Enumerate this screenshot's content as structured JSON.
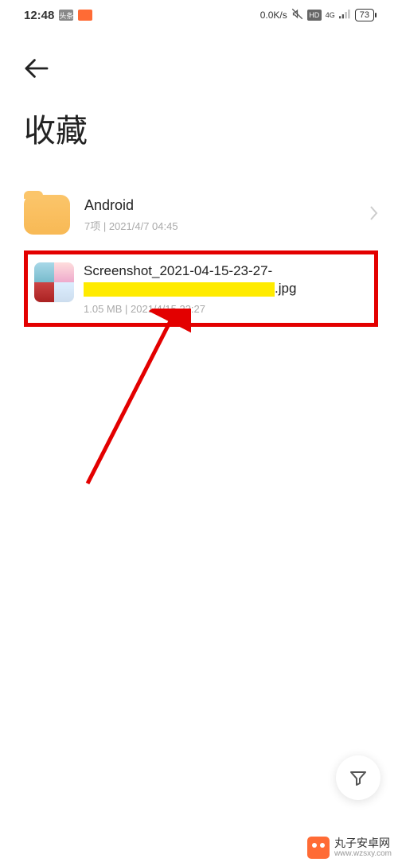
{
  "status": {
    "time": "12:48",
    "badge1": "头条",
    "badge2": "",
    "speed": "0.0K/s",
    "hd": "HD",
    "net": "4G",
    "battery": "73"
  },
  "page": {
    "title": "收藏"
  },
  "folder": {
    "name": "Android",
    "sub": "7项  |  2021/4/7 04:45"
  },
  "file": {
    "name_line1": "Screenshot_2021-04-15-23-27-",
    "name_ext": ".jpg",
    "sub": "1.05 MB  |  2021/4/15 23:27"
  },
  "watermark": {
    "cn": "丸子安卓网",
    "url": "www.wzsxy.com"
  }
}
